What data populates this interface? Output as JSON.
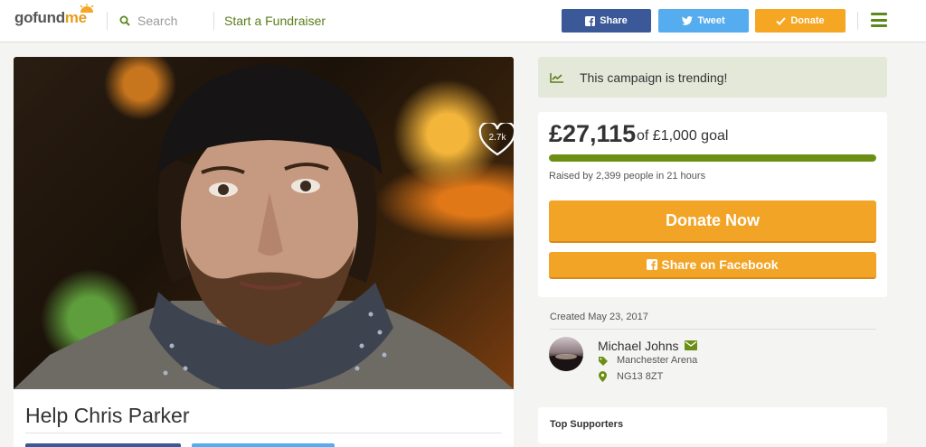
{
  "header": {
    "logo_go": "gofund",
    "logo_me": "me",
    "search_placeholder": "Search",
    "start_label": "Start a Fundraiser",
    "share_label": "Share",
    "tweet_label": "Tweet",
    "donate_label": "Donate"
  },
  "campaign": {
    "title": "Help Chris Parker",
    "hearts": "2.7k",
    "trending": "This campaign is trending!",
    "raised": "£27,115",
    "goal_text": "of £1,000 goal",
    "progress_fraction": 1.0,
    "raised_by": "Raised by 2,399 people in 21 hours",
    "donate_now": "Donate Now",
    "share_facebook": "Share on Facebook",
    "created": "Created May 23, 2017"
  },
  "organizer": {
    "name": "Michael Johns",
    "category": "Manchester Arena",
    "location": "NG13 8ZT"
  },
  "supporters": {
    "title": "Top Supporters"
  },
  "colors": {
    "brand_green": "#5a7d1a",
    "facebook": "#3b5998",
    "twitter": "#55acee",
    "donate_orange": "#f2a427",
    "progress": "#6b8f14"
  },
  "icons": [
    "search-icon",
    "facebook-icon",
    "twitter-icon",
    "check-icon",
    "menu-icon",
    "heart-icon",
    "trending-icon",
    "mail-icon",
    "tag-icon",
    "pin-icon"
  ]
}
